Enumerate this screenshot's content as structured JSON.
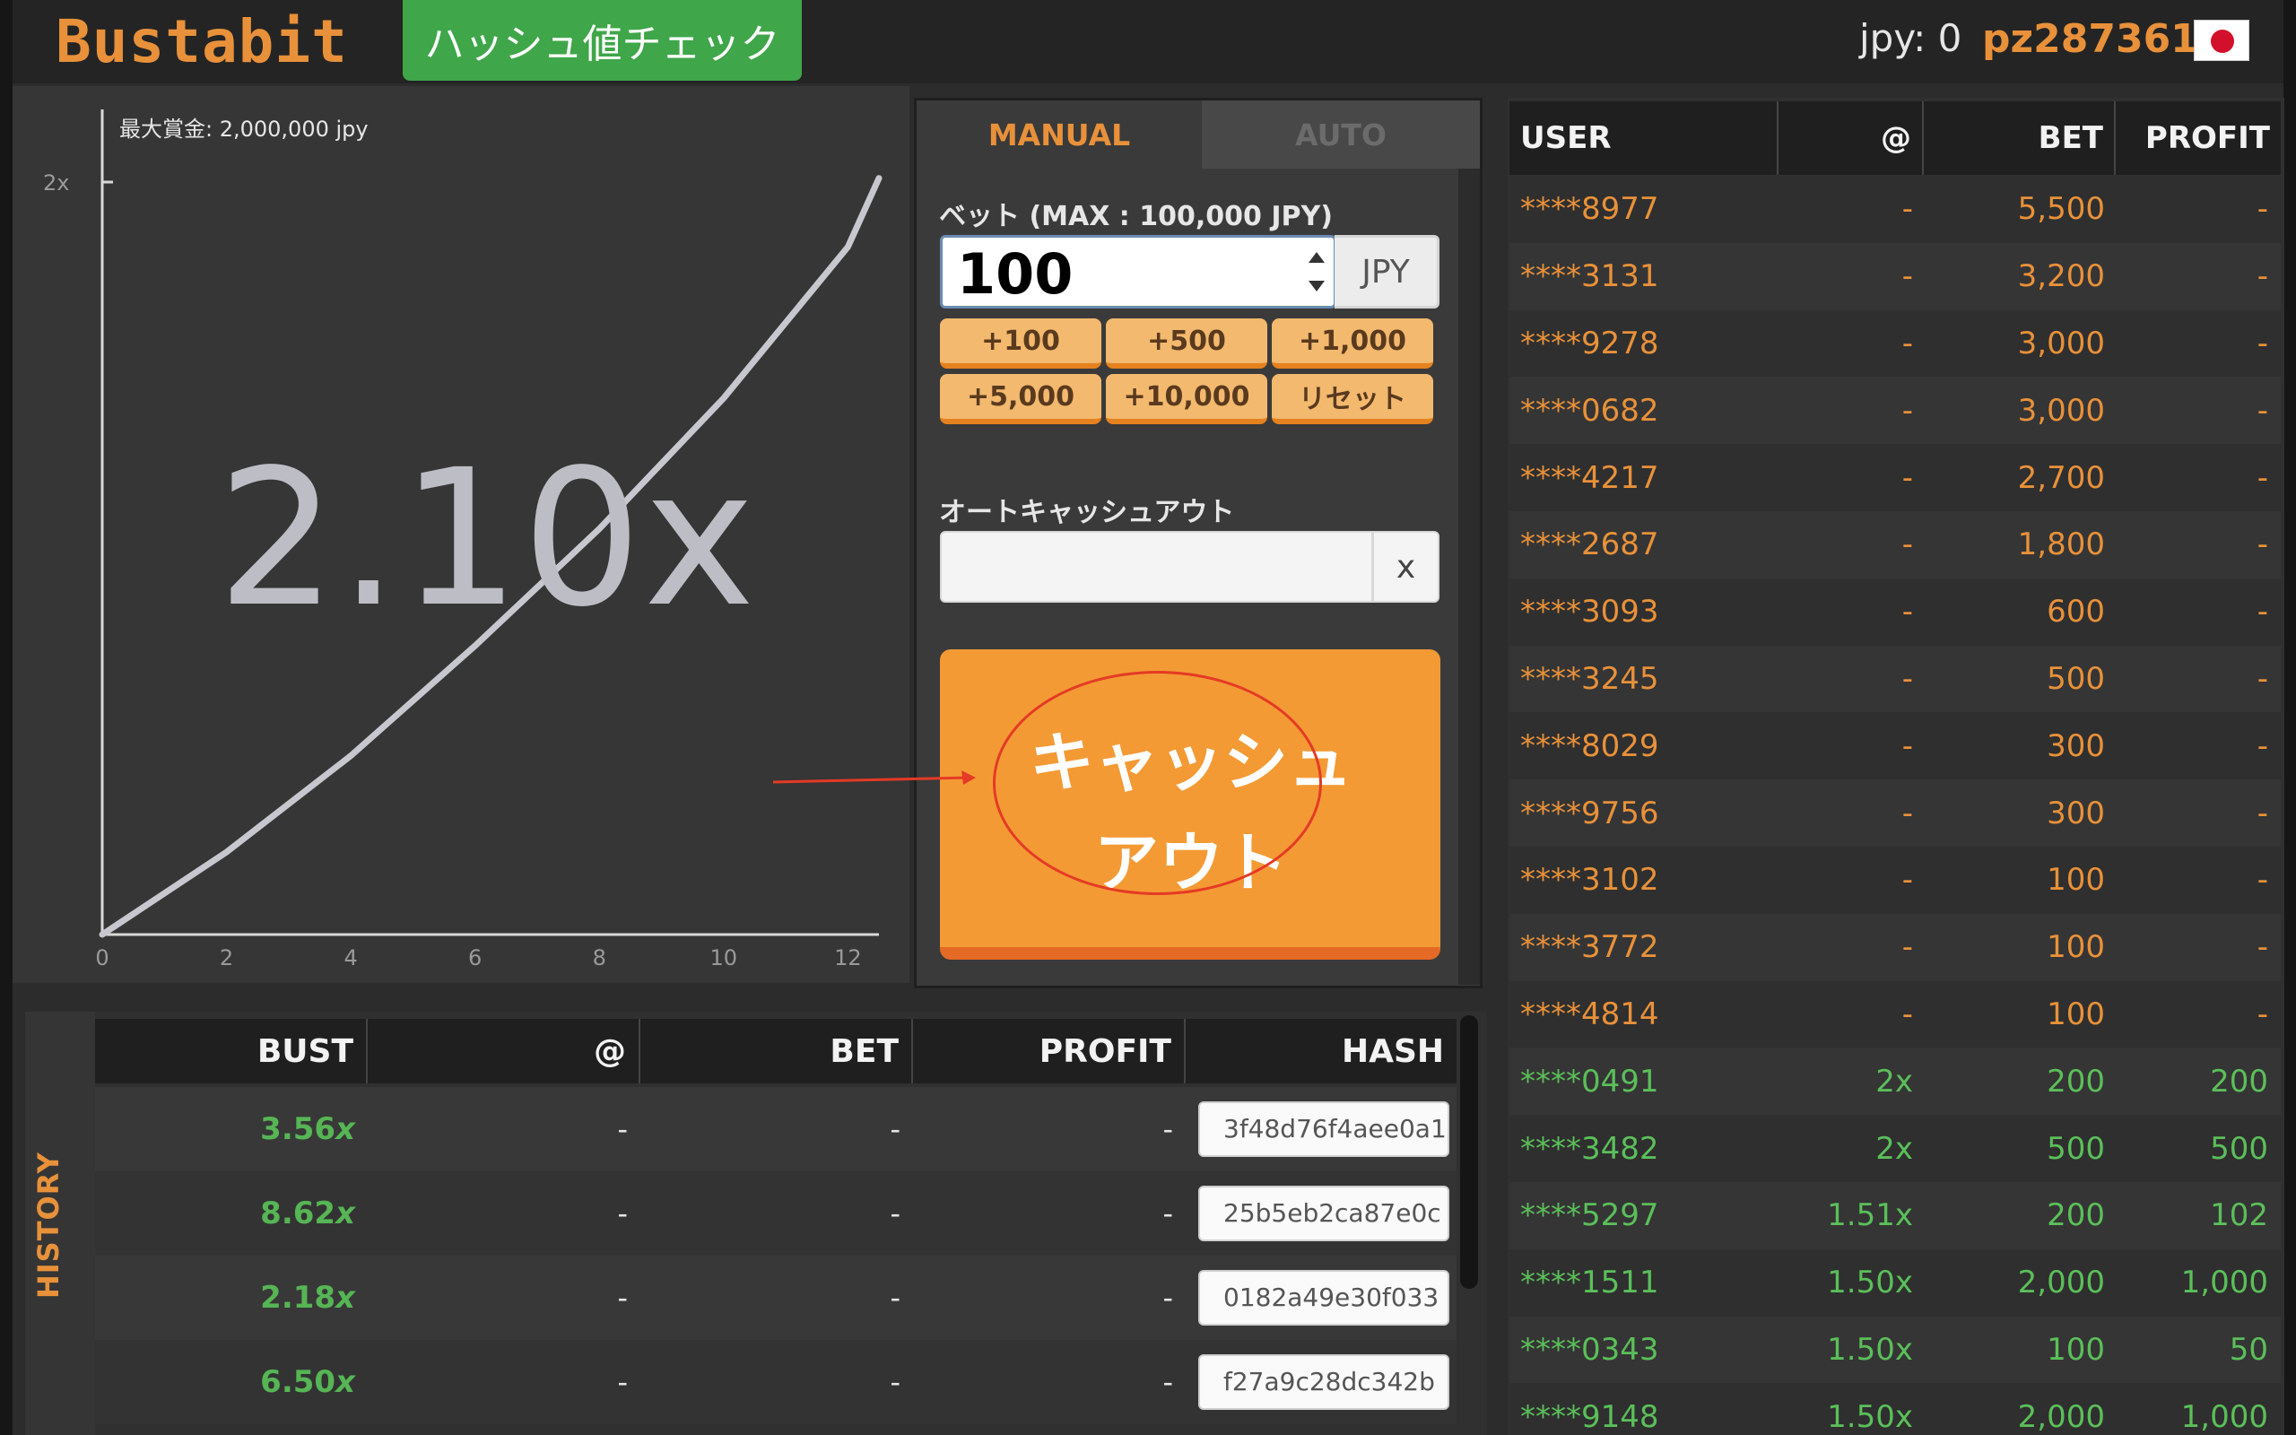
{
  "header": {
    "logo": "Bustabit",
    "hash_check_button": "ハッシュ値チェック",
    "balance": "jpy: 0",
    "username": "pz287361",
    "flag_icon": "japan-flag-icon"
  },
  "chart": {
    "max_prize": "最大賞金: 2,000,000 jpy",
    "y_tick": "2x",
    "x_ticks": [
      "0",
      "2",
      "4",
      "6",
      "8",
      "10",
      "12"
    ],
    "multiplier": "2.10x"
  },
  "chart_data": {
    "type": "line",
    "title": "",
    "xlabel": "",
    "ylabel": "",
    "xlim": [
      0,
      12.5
    ],
    "ylim": [
      1,
      2.2
    ],
    "series": [
      {
        "x": [
          0,
          2,
          4,
          6,
          8,
          10,
          12,
          12.5
        ],
        "y": [
          1.0,
          1.12,
          1.26,
          1.42,
          1.59,
          1.78,
          2.0,
          2.1
        ]
      }
    ]
  },
  "bet_panel": {
    "tab_manual": "MANUAL",
    "tab_auto": "AUTO",
    "bet_label": "ベット (MAX : 100,000 JPY)",
    "bet_value": "100",
    "currency": "JPY",
    "quick_buttons": [
      "+100",
      "+500",
      "+1,000",
      "+5,000",
      "+10,000",
      "リセット"
    ],
    "auto_cashout_label": "オートキャッシュアウト",
    "auto_cashout_value": "",
    "auto_cashout_suffix": "x",
    "cashout_button_line1": "キャッシュ",
    "cashout_button_line2": "アウト"
  },
  "history": {
    "side_label": "HISTORY",
    "columns": [
      "BUST",
      "@",
      "BET",
      "PROFIT",
      "HASH"
    ],
    "rows": [
      {
        "bust": "3.56",
        "suffix": "x",
        "at": "-",
        "bet": "-",
        "profit": "-",
        "hash": "3f48d76f4aee0a1"
      },
      {
        "bust": "8.62",
        "suffix": "x",
        "at": "-",
        "bet": "-",
        "profit": "-",
        "hash": "25b5eb2ca87e0c"
      },
      {
        "bust": "2.18",
        "suffix": "x",
        "at": "-",
        "bet": "-",
        "profit": "-",
        "hash": "0182a49e30f033"
      },
      {
        "bust": "6.50",
        "suffix": "x",
        "at": "-",
        "bet": "-",
        "profit": "-",
        "hash": "f27a9c28dc342b"
      }
    ]
  },
  "players": {
    "columns": [
      "USER",
      "@",
      "BET",
      "PROFIT"
    ],
    "rows": [
      {
        "user": "****8977",
        "at": "-",
        "bet": "5,500",
        "profit": "-",
        "status": "orange"
      },
      {
        "user": "****3131",
        "at": "-",
        "bet": "3,200",
        "profit": "-",
        "status": "orange"
      },
      {
        "user": "****9278",
        "at": "-",
        "bet": "3,000",
        "profit": "-",
        "status": "orange"
      },
      {
        "user": "****0682",
        "at": "-",
        "bet": "3,000",
        "profit": "-",
        "status": "orange"
      },
      {
        "user": "****4217",
        "at": "-",
        "bet": "2,700",
        "profit": "-",
        "status": "orange"
      },
      {
        "user": "****2687",
        "at": "-",
        "bet": "1,800",
        "profit": "-",
        "status": "orange"
      },
      {
        "user": "****3093",
        "at": "-",
        "bet": "600",
        "profit": "-",
        "status": "orange"
      },
      {
        "user": "****3245",
        "at": "-",
        "bet": "500",
        "profit": "-",
        "status": "orange"
      },
      {
        "user": "****8029",
        "at": "-",
        "bet": "300",
        "profit": "-",
        "status": "orange"
      },
      {
        "user": "****9756",
        "at": "-",
        "bet": "300",
        "profit": "-",
        "status": "orange"
      },
      {
        "user": "****3102",
        "at": "-",
        "bet": "100",
        "profit": "-",
        "status": "orange"
      },
      {
        "user": "****3772",
        "at": "-",
        "bet": "100",
        "profit": "-",
        "status": "orange"
      },
      {
        "user": "****4814",
        "at": "-",
        "bet": "100",
        "profit": "-",
        "status": "orange"
      },
      {
        "user": "****0491",
        "at": "2x",
        "bet": "200",
        "profit": "200",
        "status": "green"
      },
      {
        "user": "****3482",
        "at": "2x",
        "bet": "500",
        "profit": "500",
        "status": "green"
      },
      {
        "user": "****5297",
        "at": "1.51x",
        "bet": "200",
        "profit": "102",
        "status": "green"
      },
      {
        "user": "****1511",
        "at": "1.50x",
        "bet": "2,000",
        "profit": "1,000",
        "status": "green"
      },
      {
        "user": "****0343",
        "at": "1.50x",
        "bet": "100",
        "profit": "50",
        "status": "green"
      },
      {
        "user": "****9148",
        "at": "1.50x",
        "bet": "2,000",
        "profit": "1,000",
        "status": "green"
      }
    ]
  },
  "colors": {
    "accent": "#e8913a",
    "success": "#56b554",
    "annotation": "#e53a25"
  }
}
